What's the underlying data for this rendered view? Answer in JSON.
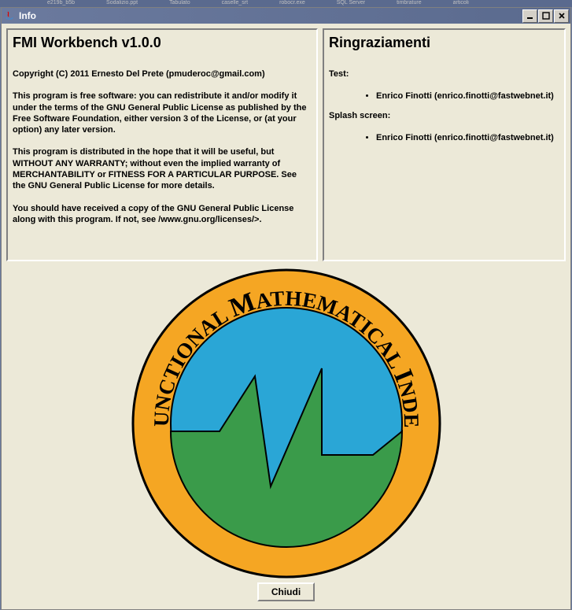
{
  "window": {
    "title": "Info"
  },
  "leftPanel": {
    "heading": "FMI Workbench v1.0.0",
    "copyright": "Copyright (C) 2011 Ernesto Del Prete (pmuderoc@gmail.com)",
    "para1": "This program is free software: you can redistribute it and/or modify it under the terms of the GNU General Public License as published by the Free Software Foundation, either version 3 of the License, or (at your option) any later version.",
    "para2": "This program is distributed in the hope that it will be useful, but WITHOUT ANY WARRANTY; without even the implied warranty of MERCHANTABILITY or FITNESS FOR A PARTICULAR PURPOSE. See the GNU General Public License for more details.",
    "para3": "You should have received a copy of the GNU General Public License along with this program. If not, see /www.gnu.org/licenses/>."
  },
  "rightPanel": {
    "heading": "Ringraziamenti",
    "testLabel": "Test:",
    "testCredit": "Enrico Finotti (enrico.finotti@fastwebnet.it)",
    "splashLabel": "Splash screen:",
    "splashCredit": "Enrico Finotti (enrico.finotti@fastwebnet.it)"
  },
  "logo": {
    "textTop": "FUNCTIONAL MATHEMATICAL INDEX"
  },
  "buttons": {
    "close": "Chiudi"
  }
}
